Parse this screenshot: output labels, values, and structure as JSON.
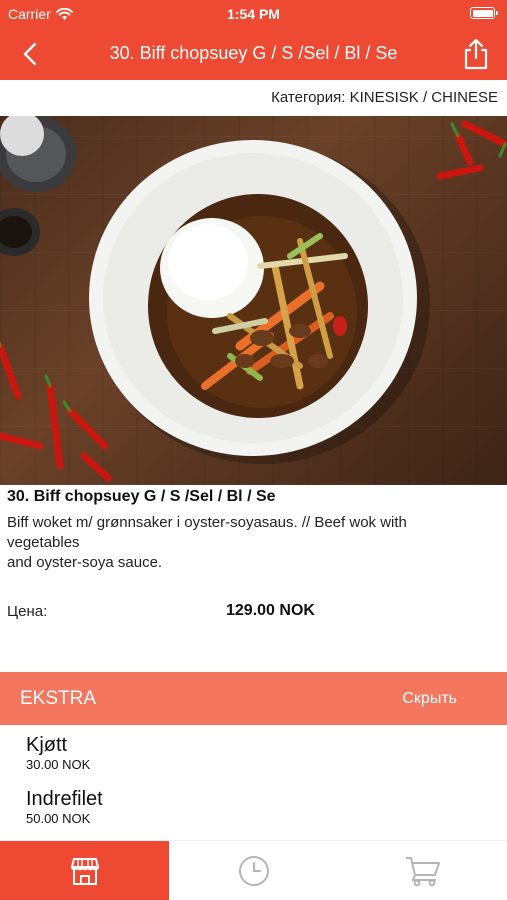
{
  "status_bar": {
    "carrier": "Carrier",
    "time": "1:54 PM"
  },
  "nav": {
    "title": "30. Biff chopsuey G / S /Sel / Bl / Se"
  },
  "category": {
    "text": "Категория: KINESISK / CHINESE"
  },
  "dish": {
    "name": "30. Biff chopsuey G / S /Sel / Bl / Se",
    "description": "Biff woket m/ grønnsaker i oyster-soyasaus. // Beef wok with vegetables\nand oyster-soya sauce.",
    "price_label": "Цена:",
    "price": "129.00 NOK"
  },
  "extra": {
    "title": "EKSTRA",
    "hide_label": "Скрыть",
    "items": [
      {
        "name": "Kjøtt",
        "price": "30.00 NOK"
      },
      {
        "name": "Indrefilet",
        "price": "50.00 NOK"
      }
    ]
  },
  "tabs": [
    {
      "icon": "store-icon",
      "active": true
    },
    {
      "icon": "clock-icon",
      "active": false
    },
    {
      "icon": "cart-icon",
      "active": false
    }
  ],
  "colors": {
    "accent": "#ee4a33",
    "extra_header": "#f4765f",
    "inactive_icon": "#b5b5b5"
  }
}
